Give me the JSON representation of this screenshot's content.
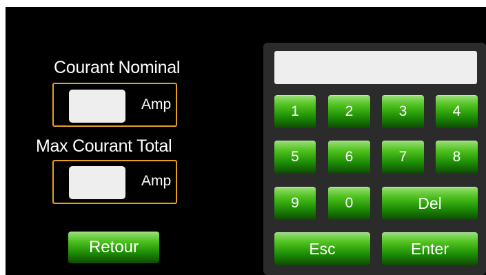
{
  "nominal": {
    "label": "Courant Nominal",
    "value": "",
    "unit": "Amp"
  },
  "max_total": {
    "label": "Max Courant Total",
    "value": "",
    "unit": "Amp"
  },
  "back_button": "Retour",
  "keypad": {
    "display": "",
    "keys": {
      "k1": "1",
      "k2": "2",
      "k3": "3",
      "k4": "4",
      "k5": "5",
      "k6": "6",
      "k7": "7",
      "k8": "8",
      "k9": "9",
      "k0": "0",
      "del": "Del",
      "esc": "Esc",
      "enter": "Enter"
    }
  },
  "colors": {
    "background": "#000000",
    "box_border": "#e7a11b",
    "button_green": "#2a9a0a",
    "keypad_panel": "#2b2b2b"
  }
}
